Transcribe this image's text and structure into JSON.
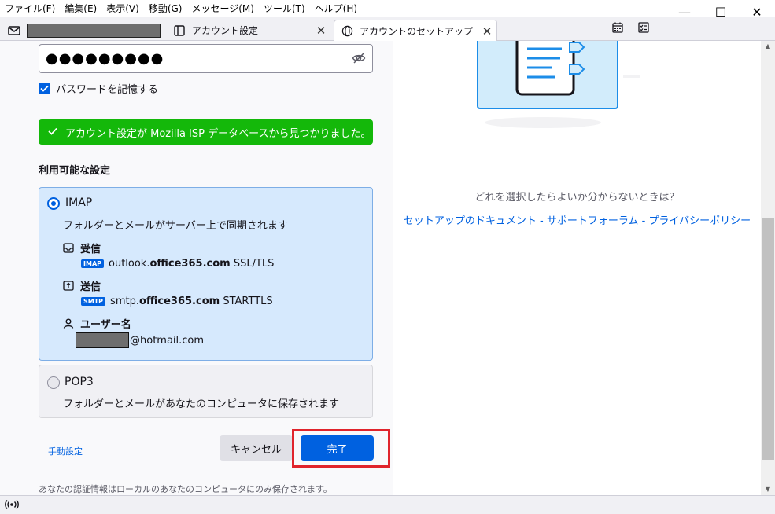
{
  "menubar": {
    "items": [
      "ファイル(F)",
      "編集(E)",
      "表示(V)",
      "移動(G)",
      "メッセージ(M)",
      "ツール(T)",
      "ヘルプ(H)"
    ]
  },
  "window_controls": {
    "minimize": "—",
    "maximize": "☐",
    "close": "✕"
  },
  "tabs": [
    {
      "label": "",
      "icon": "mail-icon"
    },
    {
      "label": "アカウント設定",
      "icon": "settings-tab-icon"
    },
    {
      "label": "アカウントのセットアップ",
      "icon": "globe-icon"
    }
  ],
  "tab_close": "✕",
  "form": {
    "password_value": "●●●●●●●●●",
    "remember_password_label": "パスワードを記憶する",
    "banner_text": "アカウント設定が Mozilla ISP データベースから見つかりました。",
    "available_settings_title": "利用可能な設定",
    "imap": {
      "title": "IMAP",
      "description": "フォルダーとメールがサーバー上で同期されます",
      "incoming_label": "受信",
      "incoming_badge": "IMAP",
      "incoming_host_prefix": "outlook.",
      "incoming_host_bold": "office365.com",
      "incoming_security": "SSL/TLS",
      "outgoing_label": "送信",
      "outgoing_badge": "SMTP",
      "outgoing_host_prefix": "smtp.",
      "outgoing_host_bold": "office365.com",
      "outgoing_security": "STARTTLS",
      "username_label": "ユーザー名",
      "username_suffix": "@hotmail.com"
    },
    "pop3": {
      "title": "POP3",
      "description": "フォルダーとメールがあなたのコンピュータに保存されます"
    },
    "manual_config_link": "手動設定",
    "cancel_label": "キャンセル",
    "done_label": "完了",
    "footer_note": "あなたの認証情報はローカルのあなたのコンピュータにのみ保存されます。"
  },
  "help": {
    "question": "どれを選択したらよいか分からないときは？",
    "links": [
      "セットアップのドキュメント",
      "サポートフォーラム",
      "プライバシーポリシー"
    ],
    "separator": " - "
  },
  "colors": {
    "accent": "#0061e0",
    "success": "#14b80a",
    "highlight": "#e0242c",
    "imap_bg": "#d6e9fd"
  }
}
